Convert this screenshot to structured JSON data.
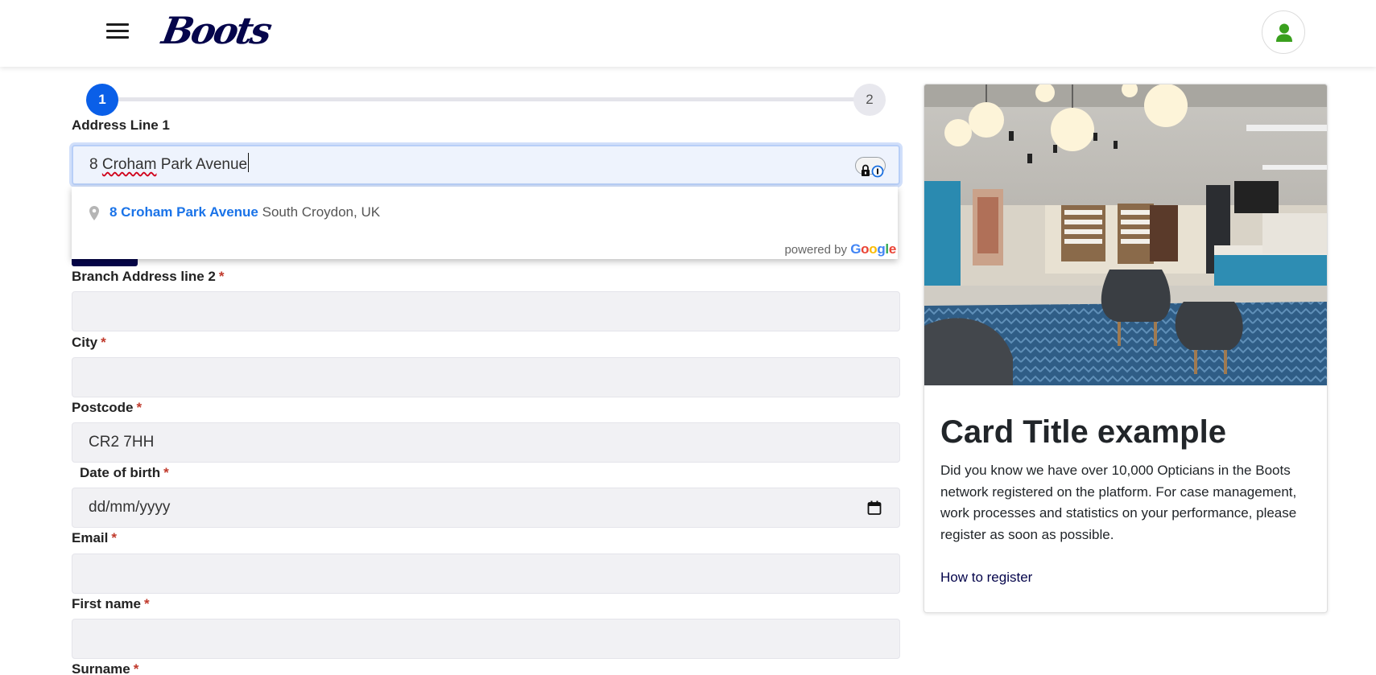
{
  "header": {
    "brand": "Boots",
    "menu_icon": "hamburger-menu-icon",
    "profile_icon": "user-icon",
    "brand_color": "#05054b",
    "profile_color": "#3aa01e"
  },
  "stepper": {
    "steps": [
      "1",
      "2"
    ],
    "current_step": 1,
    "active_color": "#0a5fe8"
  },
  "form": {
    "address_line_1": {
      "label": "Address Line 1",
      "value_prefix": "8 ",
      "value_misspelled": "Croham",
      "value_suffix": " Park Avenue",
      "password_manager_icon": "password-manager-icon"
    },
    "autocomplete": {
      "suggestion_match": "8 Croham Park Avenue",
      "suggestion_rest": "South Croydon, UK",
      "powered_by": "powered by",
      "google": "Google"
    },
    "branch_address_line_2": {
      "label": "Branch Address line 2",
      "required": "*",
      "value": ""
    },
    "city": {
      "label": "City",
      "required": "*",
      "value": ""
    },
    "postcode": {
      "label": "Postcode",
      "required": "*",
      "value": "CR2 7HH"
    },
    "date_of_birth": {
      "label": "Date of birth",
      "required": "*",
      "placeholder": "dd/mm/yyyy",
      "icon": "calendar-icon"
    },
    "email": {
      "label": "Email",
      "required": "*",
      "value": ""
    },
    "first_name": {
      "label": "First name",
      "required": "*",
      "value": ""
    },
    "surname": {
      "label": "Surname",
      "required": "*"
    }
  },
  "card": {
    "title": "Card Title example",
    "text": "Did you know we have over 10,000 Opticians in the Boots network registered on the platform. For case management, work processes and statistics on your performance, please register as soon as possible.",
    "link": "How to register"
  }
}
